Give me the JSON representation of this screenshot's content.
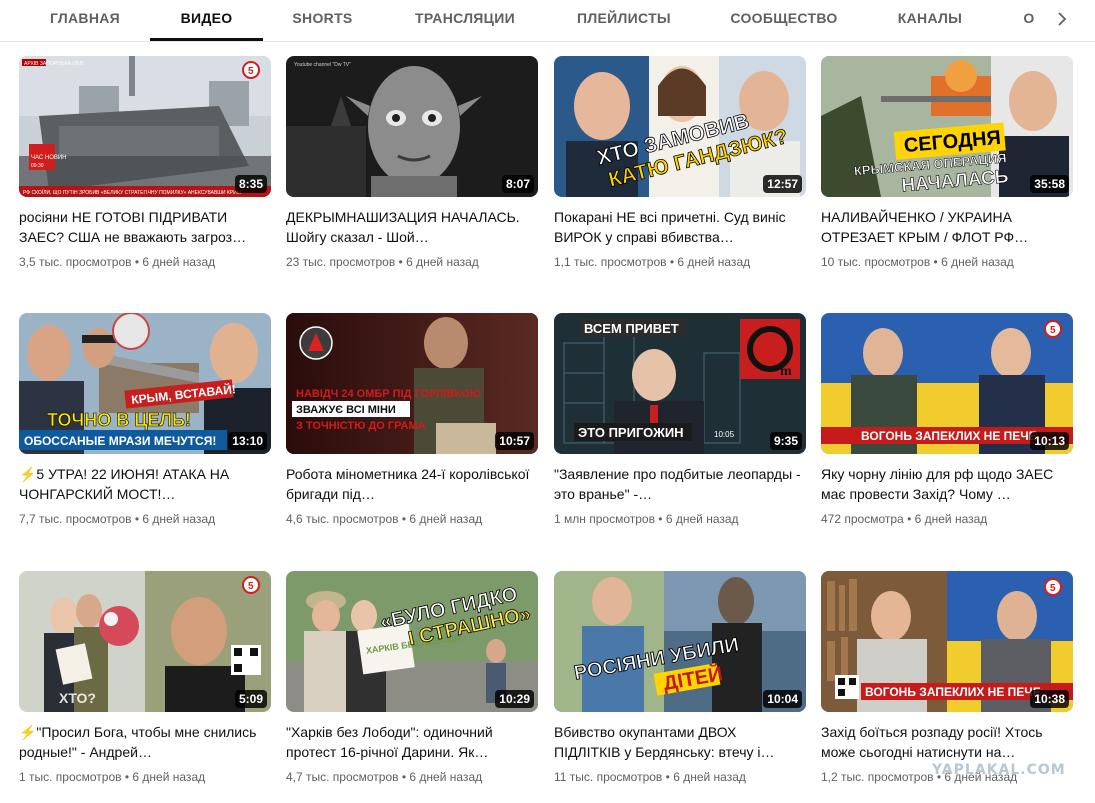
{
  "tabs": {
    "home": "ГЛАВНАЯ",
    "videos": "ВИДЕО",
    "shorts": "SHORTS",
    "live": "ТРАНСЛЯЦИИ",
    "playlists": "ПЛЕЙЛИСТЫ",
    "community": "СООБЩЕСТВО",
    "channels": "КАНАЛЫ",
    "about": "О",
    "active": "videos"
  },
  "videos": [
    {
      "title": "росіяни НЕ ГОТОВІ ПІДРИВАТИ ЗАЕС? США не вважають загроз…",
      "duration": "8:35",
      "views": "3,5 тыс. просмотров",
      "age": "6 дней назад",
      "thumb_text": [
        "АРХІВ ЗАПОРІЗЬКА ОБЛ.",
        "ЧАС НОВИН",
        "09:30",
        "РФ СКОЇЛИ, ЩО ПУТІН ЗРОБИВ «ВЕЛИКУ СТРАТЕГІЧНУ ПОМИЛКУ» АНЕКСУВАВШИ КРИМ",
        "5"
      ]
    },
    {
      "title": "ДЕКРЫМНАШИЗАЦИЯ НАЧАЛАСЬ. Шойгу сказал - Шой…",
      "duration": "8:07",
      "views": "23 тыс. просмотров",
      "age": "6 дней назад",
      "thumb_text": [
        "Youtube channel \"Dw TV\""
      ]
    },
    {
      "title": "Покарані НЕ всі причетні. Суд виніс ВИРОК у справі вбивства…",
      "duration": "12:57",
      "views": "1,1 тыс. просмотров",
      "age": "6 дней назад",
      "thumb_text": [
        "ХТО ЗАМОВИВ",
        "КАТЮ ГАНДЗЮК?"
      ]
    },
    {
      "title": "НАЛИВАЙЧЕНКО / УКРАИНА ОТРЕЗАЕТ КРЫМ / ФЛОТ РФ…",
      "duration": "35:58",
      "views": "10 тыс. просмотров",
      "age": "6 дней назад",
      "thumb_text": [
        "СЕГОДНЯ",
        "КРЫМСКАЯ ОПЕРАЦИЯ",
        "НАЧАЛАСЬ"
      ]
    },
    {
      "title": "⚡5 УТРА! 22 ИЮНЯ! АТАКА НА ЧОНГАРСКИЙ МОСТ!…",
      "duration": "13:10",
      "views": "7,7 тыс. просмотров",
      "age": "6 дней назад",
      "thumb_text": [
        "КРЫМ, ВСТАВАЙ!",
        "ТОЧНО В ЦЕЛЬ!",
        "ОБОССАНЫЕ МРАЗИ МЕЧУТСЯ!"
      ]
    },
    {
      "title": "Робота мінометника 24-ї королівської бригади під…",
      "duration": "10:57",
      "views": "4,6 тыс. просмотров",
      "age": "6 дней назад",
      "thumb_text": [
        "НАВІДЧ 24 ОМБР ПІД ГОРЛІВКОЮ",
        "ЗВАЖУЄ ВСІ МІНИ",
        "З ТОЧНІСТЮ ДО ГРАМА"
      ]
    },
    {
      "title": "\"Заявление про подбитые леопарды - это вранье\" -…",
      "duration": "9:35",
      "views": "1 млн просмотров",
      "age": "6 дней назад",
      "thumb_text": [
        "ВСЕМ ПРИВЕТ",
        "ЭТО ПРИГОЖИН",
        "10:05",
        "m"
      ]
    },
    {
      "title": "Яку чорну лінію для рф щодо ЗАЕС має провести Захід? Чому …",
      "duration": "10:13",
      "views": "472 просмотра",
      "age": "6 дней назад",
      "thumb_text": [
        "ВОГОНЬ ЗАПЕКЛИХ НЕ ПЕЧЕ",
        "5"
      ]
    },
    {
      "title": "⚡\"Просил Бога, чтобы мне снились родные!\" - Андрей…",
      "duration": "5:09",
      "views": "1 тыс. просмотров",
      "age": "6 дней назад",
      "thumb_text": [
        "ХТО?",
        "5"
      ]
    },
    {
      "title": "\"Харків без Лободи\": одиночний протест 16-річної Дарини. Як…",
      "duration": "10:29",
      "views": "4,7 тыс. просмотров",
      "age": "6 дней назад",
      "thumb_text": [
        "«БУЛО ГИДКО",
        "І СТРАШНО»",
        "ХАРКІВ БЕЗ ЛОБОДИ"
      ]
    },
    {
      "title": "Вбивство окупантами ДВОХ ПІДЛІТКІВ у Бердянську: втечу і…",
      "duration": "10:04",
      "views": "11 тыс. просмотров",
      "age": "6 дней назад",
      "thumb_text": [
        "РОСІЯНИ УБИЛИ",
        "ДІТЕЙ"
      ]
    },
    {
      "title": "Захід боїться розпаду росії! Хтось може сьогодні натиснути на…",
      "duration": "10:38",
      "views": "1,2 тыс. просмотров",
      "age": "6 дней назад",
      "thumb_text": [
        "ВОГОНЬ ЗАПЕКЛИХ НЕ ПЕЧЕ",
        "5"
      ]
    }
  ],
  "meta_separator": "•",
  "watermark": "YAPLAKAL.COM",
  "icons": {
    "next": "chevron-right-icon"
  }
}
